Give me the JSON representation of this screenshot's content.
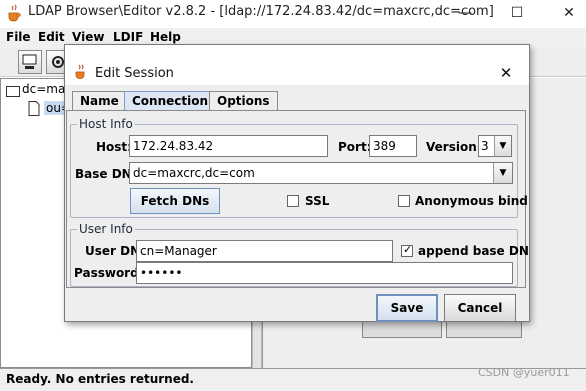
{
  "window": {
    "title": "LDAP Browser\\Editor v2.8.2 - [ldap://172.24.83.42/dc=maxcrc,dc=com]",
    "minimize_glyph": "—",
    "maximize_glyph": "☐",
    "close_glyph": "✕"
  },
  "menubar": {
    "items": [
      "File",
      "Edit",
      "View",
      "LDIF",
      "Help"
    ]
  },
  "tree": {
    "root_label": "dc=max",
    "child_label": "ou="
  },
  "status": {
    "text": "Ready. No entries returned.",
    "watermark": "CSDN @yuer011"
  },
  "dialog": {
    "title": "Edit Session",
    "close_glyph": "✕",
    "tabs": [
      "Name",
      "Connection",
      "Options"
    ],
    "active_tab": "Connection",
    "host_info": {
      "legend": "Host Info",
      "host_label": "Host:",
      "host_value": "172.24.83.42",
      "port_label": "Port:",
      "port_value": "389",
      "version_label": "Version:",
      "version_value": "3",
      "basedn_label": "Base DN:",
      "basedn_value": "dc=maxcrc,dc=com",
      "fetch_label": "Fetch DNs",
      "ssl_label": "SSL",
      "ssl_checked": false,
      "anon_label": "Anonymous bind",
      "anon_checked": false
    },
    "user_info": {
      "legend": "User Info",
      "userdn_label": "User DN:",
      "userdn_value": "cn=Manager",
      "append_label": "append base DN",
      "append_checked": true,
      "password_label": "Password:",
      "password_value": "••••••"
    },
    "buttons": {
      "save": "Save",
      "cancel": "Cancel"
    }
  },
  "colors": {
    "accent": "#6f8fbf",
    "selection": "#c8daf0"
  }
}
